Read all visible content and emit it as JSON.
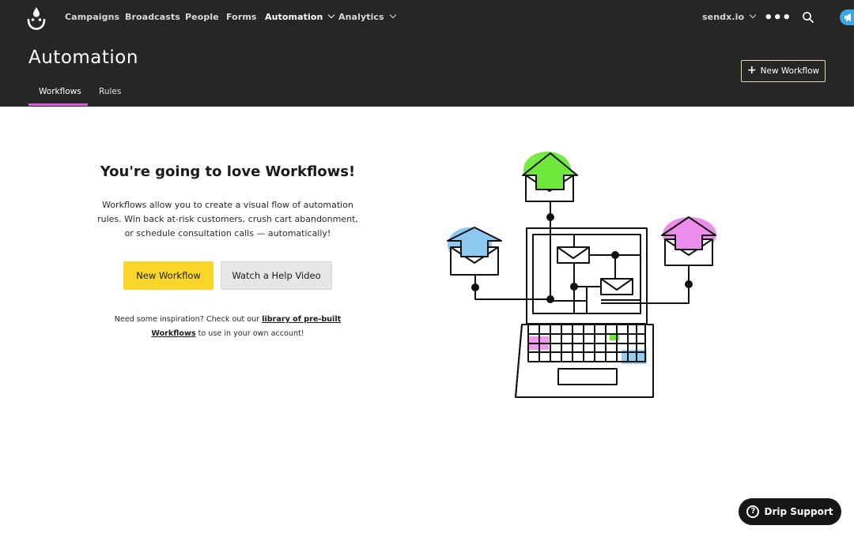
{
  "nav": {
    "items": [
      {
        "label": "Campaigns"
      },
      {
        "label": "Broadcasts"
      },
      {
        "label": "People"
      },
      {
        "label": "Forms"
      },
      {
        "label": "Automation"
      },
      {
        "label": "Analytics"
      }
    ],
    "account": "sendx.io",
    "more_glyph": "•••"
  },
  "header": {
    "title": "Automation",
    "tabs": [
      {
        "label": "Workflows"
      },
      {
        "label": "Rules"
      }
    ],
    "new_workflow_button": "New Workflow"
  },
  "main": {
    "title": "You're going to love Workflows!",
    "description": "Workflows allow you to create a visual flow of automation rules. Win back at-risk customers, crush cart abandonment, or schedule consultation calls — automatically!",
    "primary_button": "New Workflow",
    "secondary_button": "Watch a Help Video",
    "inspiration_prefix": "Need some inspiration? Check out our",
    "inspiration_link": "library of pre-built Workflows",
    "inspiration_suffix": "to use in your own account!"
  },
  "support": {
    "label": "Drip Support"
  },
  "icons": {
    "logo": "drip-logo-icon",
    "search": "search-icon",
    "notification": "megaphone-icon",
    "plus": "plus-icon",
    "help": "question-icon"
  },
  "colors": {
    "header_bg": "#262626",
    "tab_underline": "#d85ed8",
    "primary_button": "#fad62a",
    "secondary_button": "#e6e6e6",
    "support_bg": "#161616",
    "notification": "#3aa8e6",
    "accent_green": "#6ee83a",
    "accent_blue": "#8cc8f0",
    "accent_pink": "#ec8cec"
  }
}
